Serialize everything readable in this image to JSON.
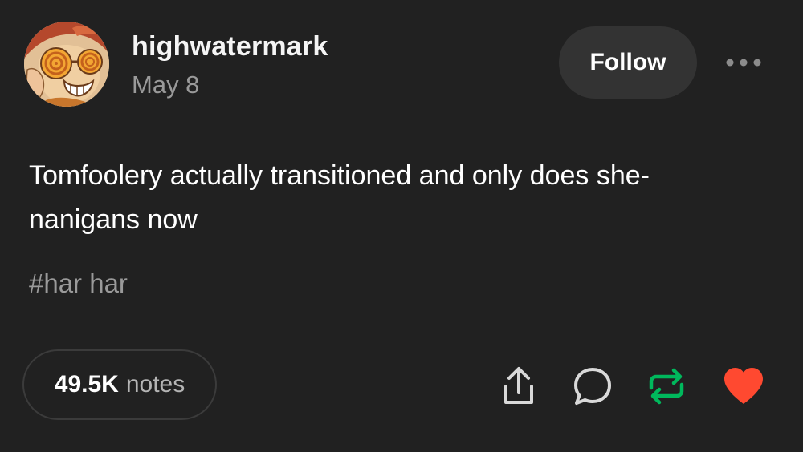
{
  "post": {
    "author": {
      "username": "highwatermark",
      "date": "May 8",
      "avatar_icon": "cartoon-avatar-icon"
    },
    "follow_label": "Follow",
    "more_icon": "ellipsis-icon",
    "text_lines": [
      "Tomfoolery actually transitioned and only does she-",
      "nanigans now"
    ],
    "tag": "#har har",
    "notes": {
      "count": "49.5K",
      "label": "notes"
    },
    "actions": [
      {
        "icon": "share-icon",
        "color": "#d9d9d9"
      },
      {
        "icon": "comment-icon",
        "color": "#d9d9d9"
      },
      {
        "icon": "reblog-icon",
        "color": "#00b85c"
      },
      {
        "icon": "like-heart-icon",
        "color": "#ff4930"
      }
    ]
  },
  "colors": {
    "background": "#212121",
    "button_bg": "#333333",
    "muted_text": "#9a9a9a",
    "reblog_green": "#00b85c",
    "like_red": "#ff4930"
  }
}
